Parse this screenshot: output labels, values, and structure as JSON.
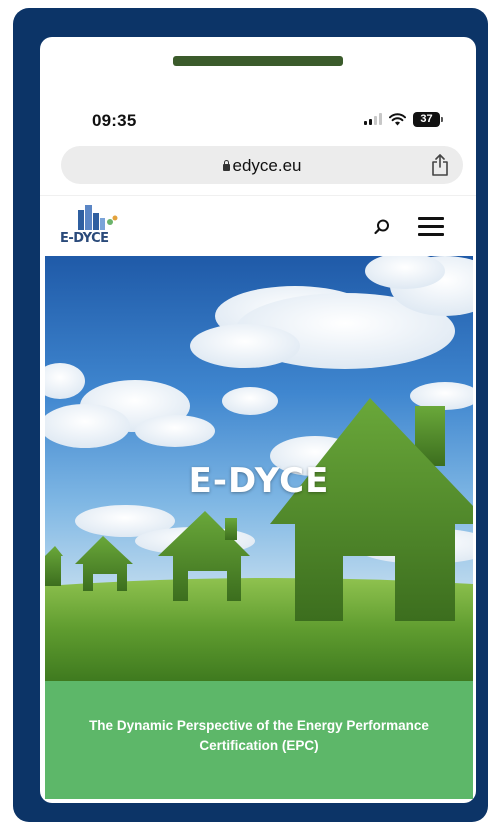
{
  "status_bar": {
    "time": "09:35",
    "battery": "37"
  },
  "browser": {
    "url": "edyce.eu"
  },
  "site": {
    "logo_text": "E-DYCE",
    "hero_title": "E-DYCE",
    "tagline": "The Dynamic Perspective of the Energy Performance Certification (EPC)"
  },
  "colors": {
    "frame": "#0c3467",
    "tagline_band": "#5db769",
    "pill": "#3b5b2b"
  }
}
